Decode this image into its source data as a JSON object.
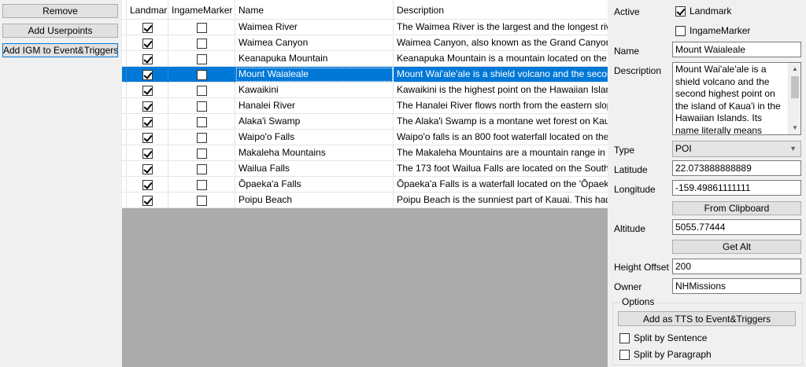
{
  "left_buttons": {
    "remove": "Remove",
    "add_userpoints": "Add Userpoints",
    "add_igm": "Add IGM to Event&Triggers"
  },
  "grid": {
    "columns": [
      "Landmark",
      "IngameMarker",
      "Name",
      "Description"
    ],
    "rows": [
      {
        "landmark": true,
        "ingame": false,
        "name": "Waimea River",
        "description": "The Waimea River is the largest and the longest river",
        "selected": false
      },
      {
        "landmark": true,
        "ingame": false,
        "name": "Waimea Canyon",
        "description": "Waimea Canyon, also known as the Grand Canyon of",
        "selected": false
      },
      {
        "landmark": true,
        "ingame": false,
        "name": "Keanapuka Mountain",
        "description": "Keanapuka Mountain is a mountain located on the H",
        "selected": false
      },
      {
        "landmark": true,
        "ingame": false,
        "name": "Mount Waialeale",
        "description": "Mount Wai'ale'ale  is a shield volcano and the secon",
        "selected": true
      },
      {
        "landmark": true,
        "ingame": false,
        "name": "Kawaikini",
        "description": "Kawaikini is the highest point on the Hawaiian Island",
        "selected": false
      },
      {
        "landmark": true,
        "ingame": false,
        "name": "Hanalei River",
        "description": "The Hanalei River flows north from the eastern slope",
        "selected": false
      },
      {
        "landmark": true,
        "ingame": false,
        "name": "Alaka'i Swamp",
        "description": "The Alaka'i Swamp is a montane wet forest on Kaua'",
        "selected": false
      },
      {
        "landmark": true,
        "ingame": false,
        "name": "Waipo'o Falls",
        "description": "Waipo'o falls is an 800 foot waterfall located on the",
        "selected": false
      },
      {
        "landmark": true,
        "ingame": false,
        "name": "Makaleha Mountains",
        "description": "The Makaleha Mountains are a mountain range in Ka",
        "selected": false
      },
      {
        "landmark": true,
        "ingame": false,
        "name": "Wailua Falls",
        "description": "The 173 foot Wailua Falls are located on the South F",
        "selected": false
      },
      {
        "landmark": true,
        "ingame": false,
        "name": "Ōpaeka'a Falls",
        "description": "Ōpaeka'a Falls is a waterfall located on the 'Ōpaeka'a",
        "selected": false
      },
      {
        "landmark": true,
        "ingame": false,
        "name": "Poipu Beach",
        "description": "Poipu Beach is the sunniest part of Kauai. This had b",
        "selected": false
      }
    ]
  },
  "panel": {
    "active_label": "Active",
    "landmark_label": "Landmark",
    "landmark_checked": true,
    "ingame_label": "IngameMarker",
    "ingame_checked": false,
    "name_label": "Name",
    "name_value": "Mount Waialeale",
    "description_label": "Description",
    "description_value": "Mount Wai'ale'ale  is a shield volcano and the second highest point on the island of Kaua'i in the Hawaiian Islands. Its name literally means \"rippling",
    "type_label": "Type",
    "type_value": "POI",
    "latitude_label": "Latitude",
    "latitude_value": "22.073888888889",
    "longitude_label": "Longitude",
    "longitude_value": "-159.49861111111",
    "from_clipboard": "From Clipboard",
    "altitude_label": "Altitude",
    "altitude_value": "5055.77444",
    "get_alt": "Get Alt",
    "height_offset_label": "Height Offset",
    "height_offset_value": "200",
    "owner_label": "Owner",
    "owner_value": "NHMissions",
    "options_label": "Options",
    "add_tts": "Add as TTS to Event&Triggers",
    "split_sentence": "Split by Sentence",
    "split_sentence_checked": false,
    "split_paragraph": "Split by Paragraph",
    "split_paragraph_checked": false
  }
}
